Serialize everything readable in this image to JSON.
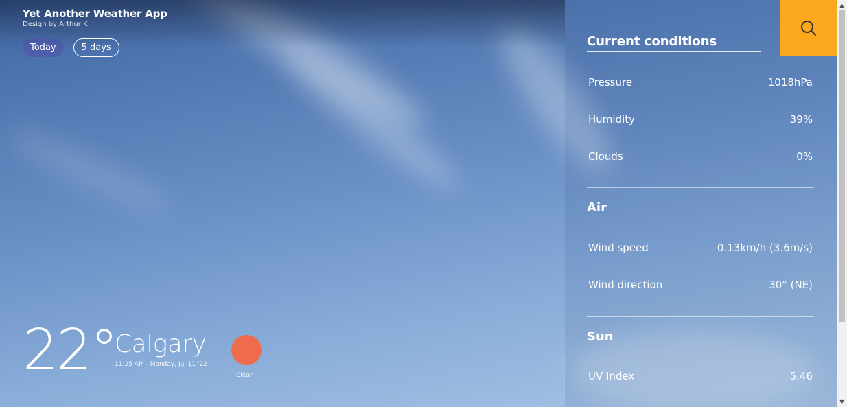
{
  "brand": {
    "title": "Yet Another Weather App",
    "subtitle": "Design by Arthur K"
  },
  "tabs": [
    {
      "label": "Today",
      "active": true
    },
    {
      "label": "5 days",
      "active": false
    }
  ],
  "current": {
    "temperature": "22°",
    "city": "Calgary",
    "datetime": "11:25 AM - Monday, Jul 11 '22",
    "condition": "Clear",
    "condition_icon": "sun-icon",
    "icon_color": "#ee6b4d"
  },
  "search": {
    "icon": "search-icon",
    "color": "#fba81c"
  },
  "sections": {
    "current_conditions": {
      "title": "Current conditions",
      "rows": [
        {
          "label": "Pressure",
          "value": "1018hPa"
        },
        {
          "label": "Humidity",
          "value": "39%"
        },
        {
          "label": "Clouds",
          "value": "0%"
        }
      ]
    },
    "air": {
      "title": "Air",
      "rows": [
        {
          "label": "Wind speed",
          "value": "0.13km/h (3.6m/s)"
        },
        {
          "label": "Wind direction",
          "value": "30° (NE)"
        }
      ]
    },
    "sun": {
      "title": "Sun",
      "rows": [
        {
          "label": "UV Index",
          "value": "5.46"
        }
      ]
    }
  }
}
